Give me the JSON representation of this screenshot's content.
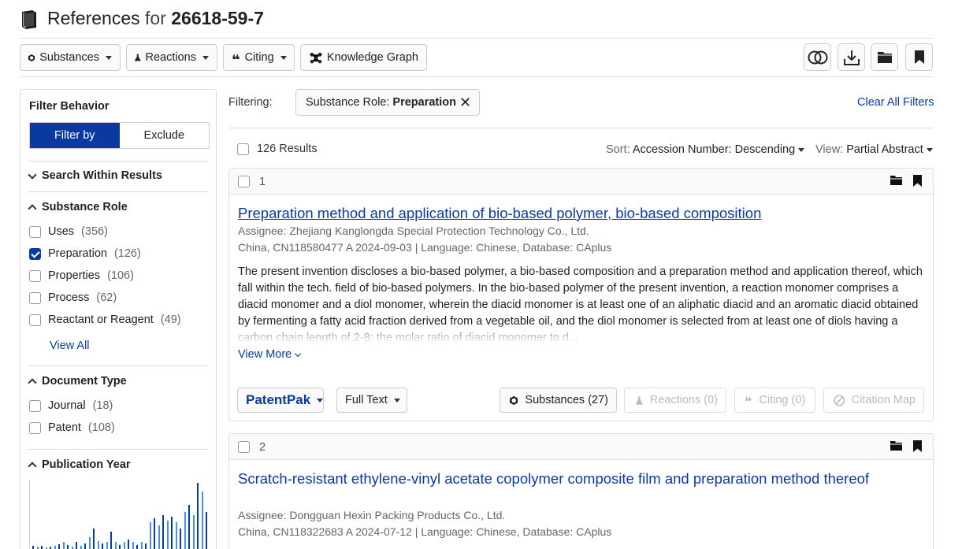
{
  "header": {
    "title_prefix": "References",
    "title_for": "for",
    "cas_number": "26618-59-7"
  },
  "toolbar": {
    "substances_label": "Substances",
    "reactions_label": "Reactions",
    "citing_label": "Citing",
    "knowledge_graph_label": "Knowledge Graph"
  },
  "sidebar": {
    "filter_behavior_label": "Filter Behavior",
    "filter_by_label": "Filter by",
    "exclude_label": "Exclude",
    "search_within_label": "Search Within Results",
    "substance_role": {
      "label": "Substance Role",
      "items": [
        {
          "label": "Uses",
          "count": "(356)",
          "checked": false
        },
        {
          "label": "Preparation",
          "count": "(126)",
          "checked": true
        },
        {
          "label": "Properties",
          "count": "(106)",
          "checked": false
        },
        {
          "label": "Process",
          "count": "(62)",
          "checked": false
        },
        {
          "label": "Reactant or Reagent",
          "count": "(49)",
          "checked": false
        }
      ],
      "view_all_label": "View All"
    },
    "document_type": {
      "label": "Document Type",
      "items": [
        {
          "label": "Journal",
          "count": "(18)",
          "checked": false
        },
        {
          "label": "Patent",
          "count": "(108)",
          "checked": false
        }
      ]
    },
    "publication_year": {
      "label": "Publication Year",
      "bar_heights_fraction": [
        0.05,
        0.03,
        0.05,
        0.02,
        0.04,
        0.05,
        0.07,
        0.1,
        0.06,
        0.04,
        0.1,
        0.05,
        0.08,
        0.18,
        0.3,
        0.12,
        0.08,
        0.1,
        0.25,
        0.1,
        0.06,
        0.1,
        0.14,
        0.1,
        0.06,
        0.1,
        0.08,
        0.4,
        0.45,
        0.35,
        0.5,
        0.42,
        0.48,
        0.4,
        0.3,
        0.55,
        0.65,
        0.5,
        0.98,
        0.85,
        0.55
      ]
    }
  },
  "filters": {
    "filtering_label": "Filtering:",
    "chip_prefix": "Substance Role:",
    "chip_value": "Preparation",
    "chip_close": "✕",
    "clear_all_label": "Clear All Filters"
  },
  "results": {
    "count_label": "126 Results",
    "sort_label": "Sort:",
    "sort_value": "Accession Number: Descending",
    "view_label": "View:",
    "view_value": "Partial Abstract",
    "items": [
      {
        "num": "1",
        "title": "Preparation method and application of bio-based polymer, bio-based composition",
        "assignee": "Assignee: Zhejiang Kanglongda Special Protection Technology Co., Ltd.",
        "details": "China, CN118580477 A 2024-09-03 | Language: Chinese, Database: CAplus",
        "abstract": "The present invention discloses a bio-based polymer, a bio-based composition and a preparation method and application thereof, which fall within the tech. field of bio-based polymers. In the bio-based polymer of the present invention, a reaction monomer comprises a diacid monomer and a diol monomer, wherein the diacid monomer is at least one of an aliphatic diacid and an aromatic diacid obtained by fermenting a fatty acid fraction derived from a vegetable oil, and the diol monomer is selected from at least one of diols having a carbon chain length of 2-8; the molar ratio of diacid monomer to d...",
        "view_more": "View More",
        "patentpak": "PatentPak",
        "full_text": "Full Text",
        "substances": "Substances (27)",
        "reactions": "Reactions (0)",
        "citing": "Citing (0)",
        "citation_map": "Citation Map"
      },
      {
        "num": "2",
        "title": "Scratch-resistant ethylene-vinyl acetate copolymer composite film and preparation method thereof",
        "assignee": "Assignee: Dongguan Hexin Packing Products Co., Ltd.",
        "details": "China, CN118322683 A 2024-07-12 | Language: Chinese, Database: CAplus"
      }
    ]
  }
}
